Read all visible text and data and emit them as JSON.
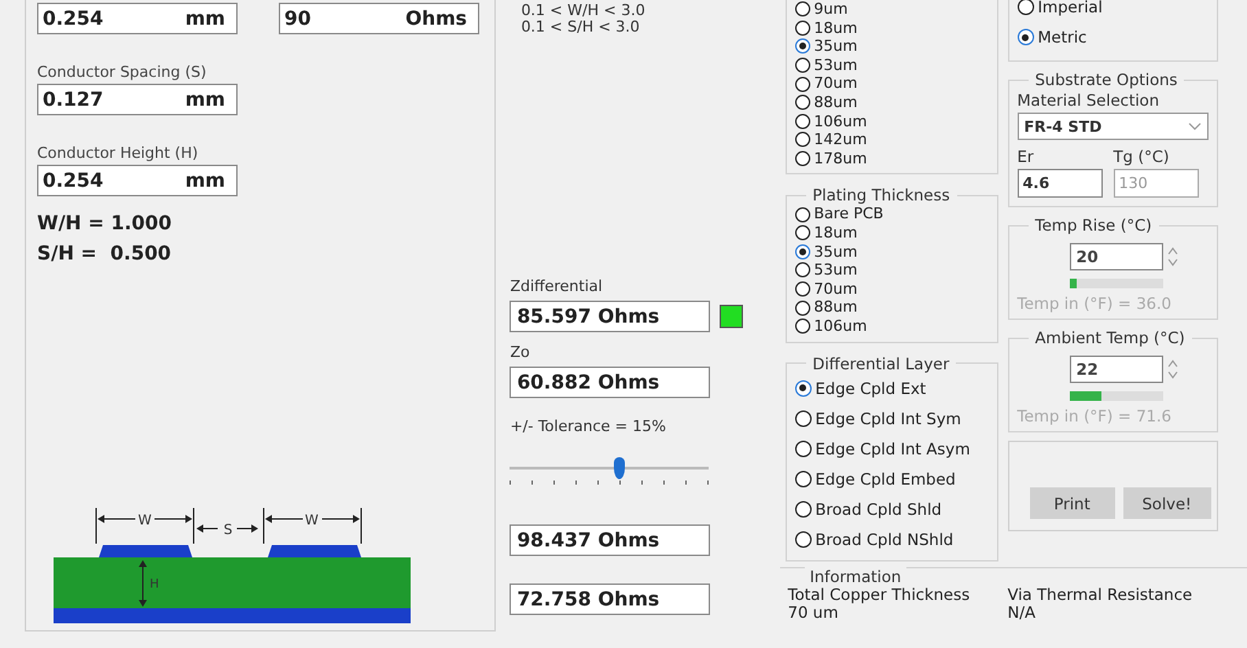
{
  "dimensions": {
    "width": {
      "value": "0.254",
      "unit": "mm"
    },
    "target": {
      "value": "90",
      "unit": "Ohms"
    },
    "fields": [
      {
        "label": "Conductor Spacing (S)",
        "value": "0.127",
        "unit": "mm"
      },
      {
        "label": "Conductor Height (H)",
        "value": "0.254",
        "unit": "mm"
      }
    ],
    "ratios": [
      "W/H = 1.000",
      "S/H =  0.500"
    ]
  },
  "diagram": {
    "labels": [
      "W",
      "S",
      "W",
      "H"
    ]
  },
  "limits": [
    "0.1 < W/H < 3.0",
    "0.1 < S/H < 3.0"
  ],
  "results": {
    "zdiff": {
      "label": "Zdifferential",
      "value": "85.597 Ohms",
      "color": "#22dd22"
    },
    "zo": {
      "label": "Zo",
      "value": "60.882 Ohms"
    },
    "tolerance": {
      "label": "+/- Tolerance = 15%",
      "level": 0.55
    },
    "upper": "98.437 Ohms",
    "lower": "72.758 Ohms"
  },
  "copper_weight": {
    "options": [
      {
        "label": "9um",
        "selected": false
      },
      {
        "label": "18um",
        "selected": false
      },
      {
        "label": "35um",
        "selected": true
      },
      {
        "label": "53um",
        "selected": false
      },
      {
        "label": "70um",
        "selected": false
      },
      {
        "label": "88um",
        "selected": false
      },
      {
        "label": "106um",
        "selected": false
      },
      {
        "label": "142um",
        "selected": false
      },
      {
        "label": "178um",
        "selected": false
      }
    ]
  },
  "plating": {
    "title": "Plating Thickness",
    "options": [
      {
        "label": "Bare PCB",
        "selected": false
      },
      {
        "label": "18um",
        "selected": false
      },
      {
        "label": "35um",
        "selected": true
      },
      {
        "label": "53um",
        "selected": false
      },
      {
        "label": "70um",
        "selected": false
      },
      {
        "label": "88um",
        "selected": false
      },
      {
        "label": "106um",
        "selected": false
      }
    ]
  },
  "differential_layer": {
    "title": "Differential Layer",
    "options": [
      {
        "label": "Edge Cpld Ext",
        "selected": true
      },
      {
        "label": "Edge Cpld Int Sym",
        "selected": false
      },
      {
        "label": "Edge Cpld Int Asym",
        "selected": false
      },
      {
        "label": "Edge Cpld Embed",
        "selected": false
      },
      {
        "label": "Broad Cpld Shld",
        "selected": false
      },
      {
        "label": "Broad Cpld NShld",
        "selected": false
      }
    ]
  },
  "units": {
    "options": [
      {
        "label": "Imperial",
        "selected": false
      },
      {
        "label": "Metric",
        "selected": true
      }
    ]
  },
  "substrate": {
    "title": "Substrate Options",
    "material_label": "Material Selection",
    "material": "FR-4 STD",
    "er_label": "Er",
    "er": "4.6",
    "tg_label": "Tg (°C)",
    "tg": "130",
    "tg_disabled": true
  },
  "temp_rise": {
    "title": "Temp Rise (°C)",
    "value": "20",
    "level": 0.08,
    "reading": "Temp in (°F) = 36.0"
  },
  "ambient_temp": {
    "title": "Ambient Temp (°C)",
    "value": "22",
    "level": 0.35,
    "reading": "Temp in (°F) = 71.6"
  },
  "buttons": [
    "Print",
    "Solve!"
  ],
  "information": {
    "title": "Information",
    "items": [
      {
        "label": "Total Copper Thickness",
        "value": "70 um"
      },
      {
        "label": "Via Thermal Resistance",
        "value": "N/A"
      }
    ]
  }
}
